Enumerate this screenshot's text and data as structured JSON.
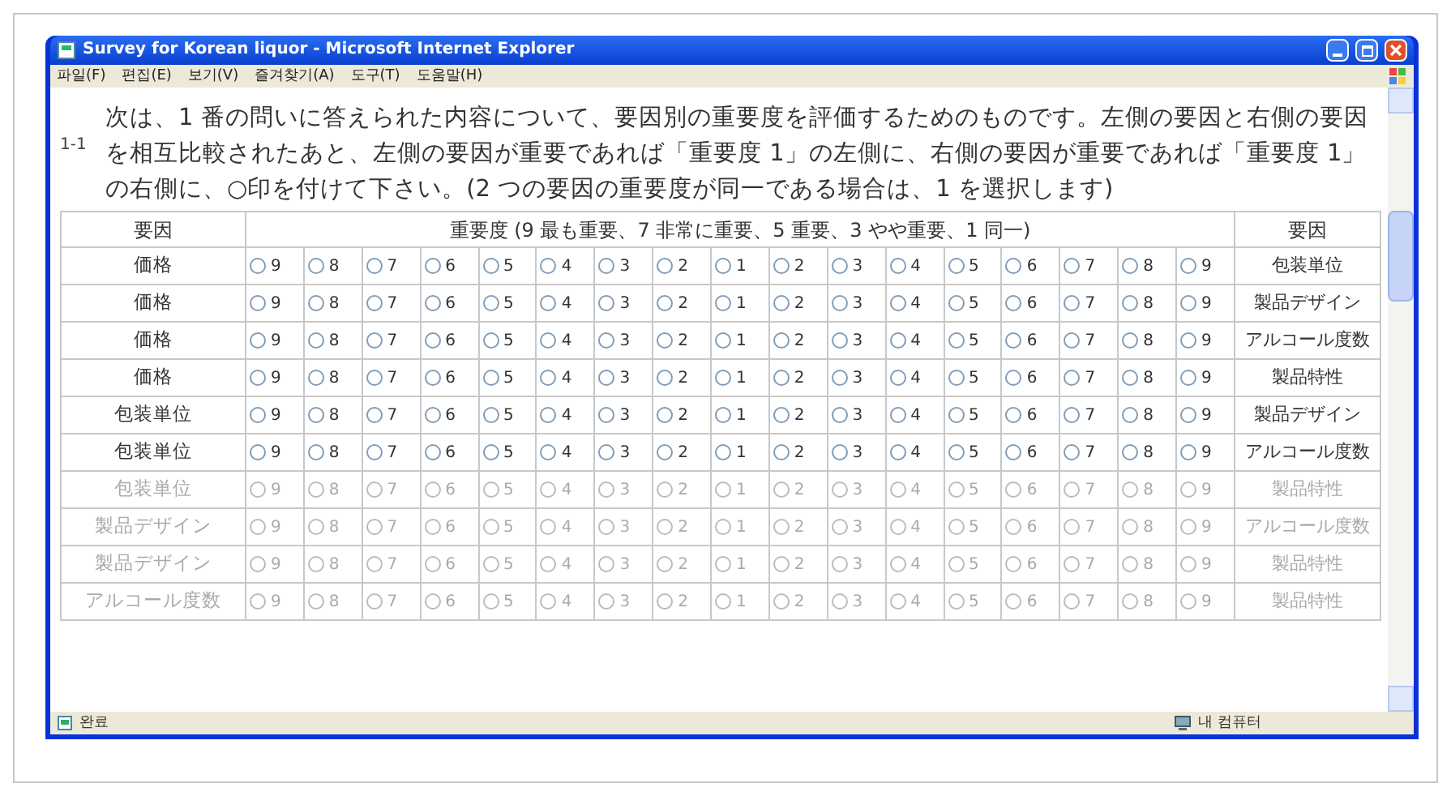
{
  "window": {
    "title": "Survey for Korean liquor - Microsoft Internet Explorer"
  },
  "menu": [
    "파일(F)",
    "편집(E)",
    "보기(V)",
    "즐겨찾기(A)",
    "도구(T)",
    "도움말(H)"
  ],
  "question": {
    "number": "1-1",
    "text": "次は、1 番の問いに答えられた内容について、要因別の重要度を評価するためのものです。左側の要因と右側の要因を相互比較されたあと、左側の要因が重要であれば「重要度 1」の左側に、右側の要因が重要であれば「重要度 1」の右側に、○印を付けて下さい。(2 つの要因の重要度が同一である場合は、1 を選択します)"
  },
  "table": {
    "columns": [
      "要因",
      "重要度 (9 最も重要、7 非常に重要、5 重要、3 やや重要、1 同一)",
      "要因"
    ],
    "rows": [
      {
        "left": "価格",
        "right": "包装単位",
        "disabled": false,
        "options": [
          {
            "label": "9",
            "selected": false
          },
          {
            "label": "8",
            "selected": false
          },
          {
            "label": "7",
            "selected": false
          },
          {
            "label": "6",
            "selected": false
          },
          {
            "label": "5",
            "selected": false
          },
          {
            "label": "4",
            "selected": false
          },
          {
            "label": "3",
            "selected": false
          },
          {
            "label": "2",
            "selected": false
          },
          {
            "label": "1",
            "selected": false
          },
          {
            "label": "2",
            "selected": false
          },
          {
            "label": "3",
            "selected": false
          },
          {
            "label": "4",
            "selected": false
          },
          {
            "label": "5",
            "selected": false
          },
          {
            "label": "6",
            "selected": false
          },
          {
            "label": "7",
            "selected": false
          },
          {
            "label": "8",
            "selected": false
          },
          {
            "label": "9",
            "selected": false
          }
        ]
      },
      {
        "left": "価格",
        "right": "製品デザイン",
        "disabled": false,
        "options": [
          {
            "label": "9",
            "selected": false
          },
          {
            "label": "8",
            "selected": false
          },
          {
            "label": "7",
            "selected": false
          },
          {
            "label": "6",
            "selected": false
          },
          {
            "label": "5",
            "selected": false
          },
          {
            "label": "4",
            "selected": false
          },
          {
            "label": "3",
            "selected": false
          },
          {
            "label": "2",
            "selected": false
          },
          {
            "label": "1",
            "selected": false
          },
          {
            "label": "2",
            "selected": false
          },
          {
            "label": "3",
            "selected": false
          },
          {
            "label": "4",
            "selected": false
          },
          {
            "label": "5",
            "selected": false
          },
          {
            "label": "6",
            "selected": false
          },
          {
            "label": "7",
            "selected": false
          },
          {
            "label": "8",
            "selected": false
          },
          {
            "label": "9",
            "selected": false
          }
        ]
      },
      {
        "left": "価格",
        "right": "アルコール度数",
        "disabled": false,
        "options": [
          {
            "label": "9",
            "selected": false
          },
          {
            "label": "8",
            "selected": false
          },
          {
            "label": "7",
            "selected": false
          },
          {
            "label": "6",
            "selected": false
          },
          {
            "label": "5",
            "selected": false
          },
          {
            "label": "4",
            "selected": false
          },
          {
            "label": "3",
            "selected": false
          },
          {
            "label": "2",
            "selected": false
          },
          {
            "label": "1",
            "selected": false
          },
          {
            "label": "2",
            "selected": false
          },
          {
            "label": "3",
            "selected": false
          },
          {
            "label": "4",
            "selected": false
          },
          {
            "label": "5",
            "selected": false
          },
          {
            "label": "6",
            "selected": false
          },
          {
            "label": "7",
            "selected": false
          },
          {
            "label": "8",
            "selected": false
          },
          {
            "label": "9",
            "selected": false
          }
        ]
      },
      {
        "left": "価格",
        "right": "製品特性",
        "disabled": false,
        "options": [
          {
            "label": "9",
            "selected": false
          },
          {
            "label": "8",
            "selected": false
          },
          {
            "label": "7",
            "selected": false
          },
          {
            "label": "6",
            "selected": false
          },
          {
            "label": "5",
            "selected": false
          },
          {
            "label": "4",
            "selected": false
          },
          {
            "label": "3",
            "selected": false
          },
          {
            "label": "2",
            "selected": false
          },
          {
            "label": "1",
            "selected": false
          },
          {
            "label": "2",
            "selected": false
          },
          {
            "label": "3",
            "selected": false
          },
          {
            "label": "4",
            "selected": false
          },
          {
            "label": "5",
            "selected": false
          },
          {
            "label": "6",
            "selected": false
          },
          {
            "label": "7",
            "selected": false
          },
          {
            "label": "8",
            "selected": false
          },
          {
            "label": "9",
            "selected": false
          }
        ]
      },
      {
        "left": "包装単位",
        "right": "製品デザイン",
        "disabled": false,
        "options": [
          {
            "label": "9",
            "selected": false
          },
          {
            "label": "8",
            "selected": false
          },
          {
            "label": "7",
            "selected": false
          },
          {
            "label": "6",
            "selected": false
          },
          {
            "label": "5",
            "selected": false
          },
          {
            "label": "4",
            "selected": false
          },
          {
            "label": "3",
            "selected": false
          },
          {
            "label": "2",
            "selected": false
          },
          {
            "label": "1",
            "selected": false
          },
          {
            "label": "2",
            "selected": false
          },
          {
            "label": "3",
            "selected": false
          },
          {
            "label": "4",
            "selected": false
          },
          {
            "label": "5",
            "selected": false
          },
          {
            "label": "6",
            "selected": false
          },
          {
            "label": "7",
            "selected": false
          },
          {
            "label": "8",
            "selected": false
          },
          {
            "label": "9",
            "selected": false
          }
        ]
      },
      {
        "left": "包装単位",
        "right": "アルコール度数",
        "disabled": false,
        "options": [
          {
            "label": "9",
            "selected": false
          },
          {
            "label": "8",
            "selected": false
          },
          {
            "label": "7",
            "selected": false
          },
          {
            "label": "6",
            "selected": false
          },
          {
            "label": "5",
            "selected": false
          },
          {
            "label": "4",
            "selected": false
          },
          {
            "label": "3",
            "selected": false
          },
          {
            "label": "2",
            "selected": false
          },
          {
            "label": "1",
            "selected": false
          },
          {
            "label": "2",
            "selected": false
          },
          {
            "label": "3",
            "selected": false
          },
          {
            "label": "4",
            "selected": false
          },
          {
            "label": "5",
            "selected": false
          },
          {
            "label": "6",
            "selected": false
          },
          {
            "label": "7",
            "selected": false
          },
          {
            "label": "8",
            "selected": false
          },
          {
            "label": "9",
            "selected": false
          }
        ]
      },
      {
        "left": "包装単位",
        "right": "製品特性",
        "disabled": true,
        "options": [
          {
            "label": "9",
            "selected": false
          },
          {
            "label": "8",
            "selected": false
          },
          {
            "label": "7",
            "selected": false
          },
          {
            "label": "6",
            "selected": false
          },
          {
            "label": "5",
            "selected": false
          },
          {
            "label": "4",
            "selected": false
          },
          {
            "label": "3",
            "selected": false
          },
          {
            "label": "2",
            "selected": false
          },
          {
            "label": "1",
            "selected": false
          },
          {
            "label": "2",
            "selected": false
          },
          {
            "label": "3",
            "selected": false
          },
          {
            "label": "4",
            "selected": false
          },
          {
            "label": "5",
            "selected": false
          },
          {
            "label": "6",
            "selected": false
          },
          {
            "label": "7",
            "selected": false
          },
          {
            "label": "8",
            "selected": false
          },
          {
            "label": "9",
            "selected": false
          }
        ]
      },
      {
        "left": "製品デザイン",
        "right": "アルコール度数",
        "disabled": true,
        "options": [
          {
            "label": "9",
            "selected": false
          },
          {
            "label": "8",
            "selected": false
          },
          {
            "label": "7",
            "selected": false
          },
          {
            "label": "6",
            "selected": false
          },
          {
            "label": "5",
            "selected": false
          },
          {
            "label": "4",
            "selected": false
          },
          {
            "label": "3",
            "selected": false
          },
          {
            "label": "2",
            "selected": false
          },
          {
            "label": "1",
            "selected": false
          },
          {
            "label": "2",
            "selected": false
          },
          {
            "label": "3",
            "selected": false
          },
          {
            "label": "4",
            "selected": false
          },
          {
            "label": "5",
            "selected": false
          },
          {
            "label": "6",
            "selected": false
          },
          {
            "label": "7",
            "selected": false
          },
          {
            "label": "8",
            "selected": false
          },
          {
            "label": "9",
            "selected": false
          }
        ]
      },
      {
        "left": "製品デザイン",
        "right": "製品特性",
        "disabled": true,
        "options": [
          {
            "label": "9",
            "selected": false
          },
          {
            "label": "8",
            "selected": false
          },
          {
            "label": "7",
            "selected": false
          },
          {
            "label": "6",
            "selected": false
          },
          {
            "label": "5",
            "selected": false
          },
          {
            "label": "4",
            "selected": false
          },
          {
            "label": "3",
            "selected": false
          },
          {
            "label": "2",
            "selected": false
          },
          {
            "label": "1",
            "selected": false
          },
          {
            "label": "2",
            "selected": false
          },
          {
            "label": "3",
            "selected": false
          },
          {
            "label": "4",
            "selected": false
          },
          {
            "label": "5",
            "selected": false
          },
          {
            "label": "6",
            "selected": false
          },
          {
            "label": "7",
            "selected": false
          },
          {
            "label": "8",
            "selected": false
          },
          {
            "label": "9",
            "selected": false
          }
        ]
      },
      {
        "left": "アルコール度数",
        "right": "製品特性",
        "disabled": true,
        "options": [
          {
            "label": "9",
            "selected": false
          },
          {
            "label": "8",
            "selected": false
          },
          {
            "label": "7",
            "selected": false
          },
          {
            "label": "6",
            "selected": false
          },
          {
            "label": "5",
            "selected": false
          },
          {
            "label": "4",
            "selected": false
          },
          {
            "label": "3",
            "selected": false
          },
          {
            "label": "2",
            "selected": false
          },
          {
            "label": "1",
            "selected": false
          },
          {
            "label": "2",
            "selected": false
          },
          {
            "label": "3",
            "selected": false
          },
          {
            "label": "4",
            "selected": false
          },
          {
            "label": "5",
            "selected": false
          },
          {
            "label": "6",
            "selected": false
          },
          {
            "label": "7",
            "selected": false
          },
          {
            "label": "8",
            "selected": false
          },
          {
            "label": "9",
            "selected": false
          }
        ]
      }
    ]
  },
  "status_bar": {
    "left": "완료",
    "right": "내 컴퓨터"
  }
}
